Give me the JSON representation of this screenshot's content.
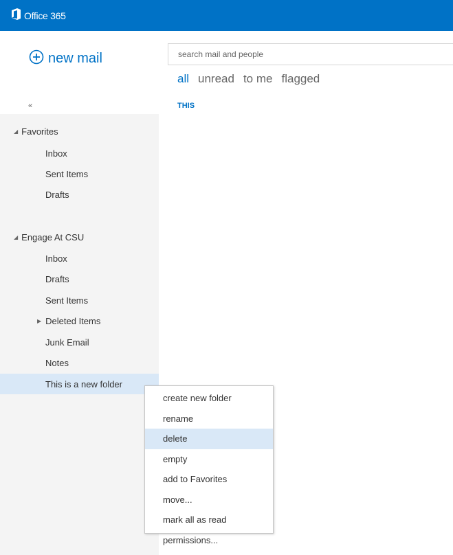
{
  "topbar": {
    "app_name": "Office 365",
    "icon": "office-logo-icon",
    "color": "#0072c6"
  },
  "new_mail": {
    "label": "new mail",
    "icon": "plus-circle-icon"
  },
  "sidebar": {
    "collapse_label": "«",
    "favorites": {
      "label": "Favorites",
      "items": [
        {
          "label": "Inbox"
        },
        {
          "label": "Sent Items"
        },
        {
          "label": "Drafts"
        }
      ]
    },
    "account": {
      "label": "Engage At CSU",
      "items": [
        {
          "label": "Inbox"
        },
        {
          "label": "Drafts"
        },
        {
          "label": "Sent Items"
        },
        {
          "label": "Deleted Items",
          "expandable": true
        },
        {
          "label": "Junk Email"
        },
        {
          "label": "Notes"
        },
        {
          "label": "This is a new folder",
          "selected": true
        }
      ]
    }
  },
  "search": {
    "placeholder": "search mail and people"
  },
  "filters": [
    {
      "label": "all",
      "active": true
    },
    {
      "label": "unread"
    },
    {
      "label": "to me"
    },
    {
      "label": "flagged"
    }
  ],
  "list": {
    "group_label": "THIS"
  },
  "context_menu": {
    "items": [
      {
        "label": "create new folder"
      },
      {
        "label": "rename"
      },
      {
        "label": "delete",
        "highlighted": true
      },
      {
        "label": "empty"
      },
      {
        "label": "add to Favorites"
      },
      {
        "label": "move..."
      },
      {
        "label": "mark all as read"
      },
      {
        "label": "permissions..."
      }
    ]
  },
  "colors": {
    "accent": "#0072c6",
    "sidebar_bg": "#f4f4f4",
    "selection": "#d9e8f7"
  }
}
